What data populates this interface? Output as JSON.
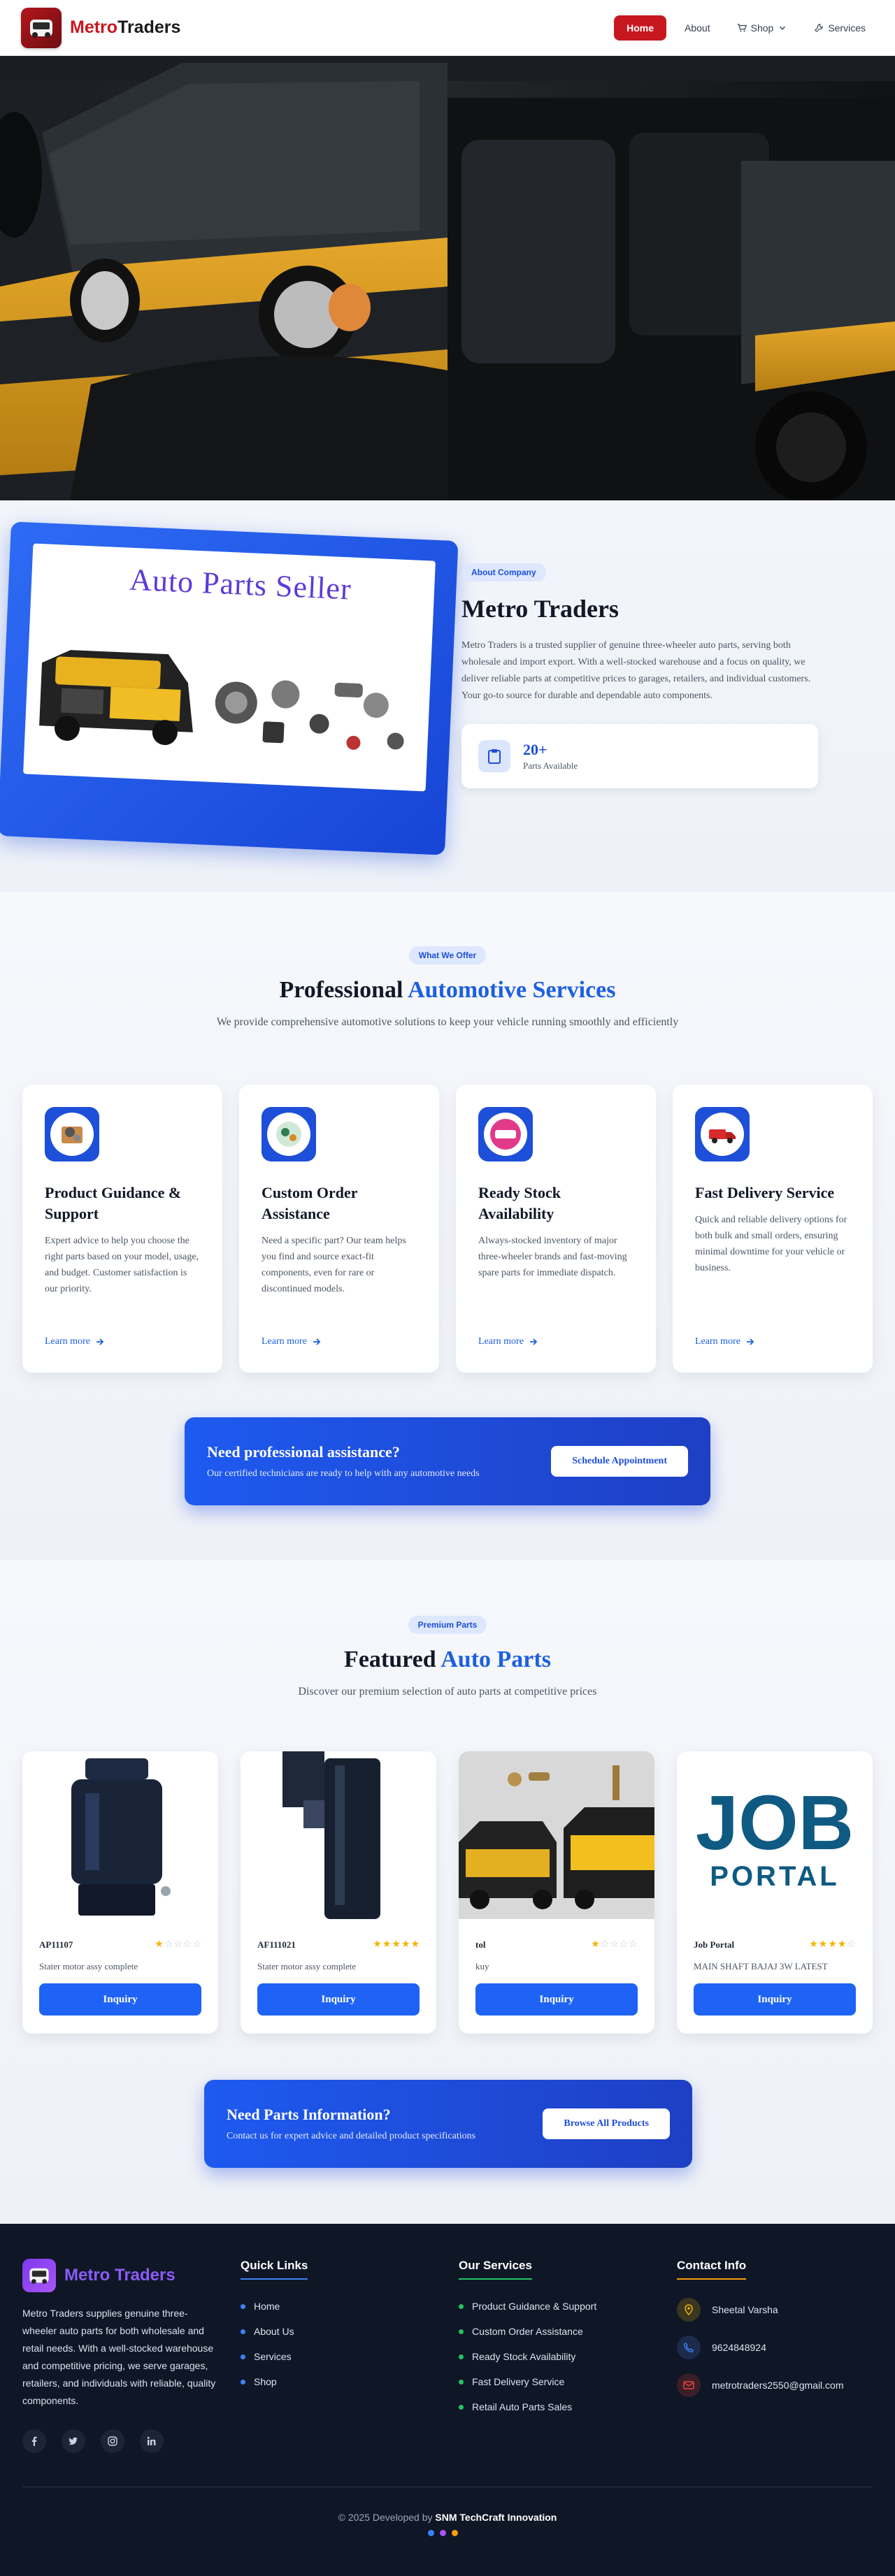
{
  "nav": {
    "brand_part1": "Metro",
    "brand_part2": "Traders",
    "links": {
      "home": "Home",
      "about": "About",
      "shop": "Shop",
      "services": "Services"
    }
  },
  "about": {
    "badge": "About Company",
    "title": "Metro Traders",
    "image_text": "Auto Parts Seller",
    "description": "Metro Traders is a trusted supplier of genuine three-wheeler auto parts, serving both wholesale and import export. With a well-stocked warehouse and a focus on quality, we deliver reliable parts at competitive prices to garages, retailers, and individual customers. Your go-to source for durable and dependable auto components.",
    "stat_value": "20+",
    "stat_label": "Parts Available"
  },
  "services": {
    "badge": "What We Offer",
    "title_plain": "Professional",
    "title_accent": "Automotive Services",
    "subtitle": "We provide comprehensive automotive solutions to keep your vehicle running smoothly and efficiently",
    "cards": [
      {
        "title": "Product Guidance & Support",
        "text": "Expert advice to help you choose the right parts based on your model, usage, and budget. Customer satisfaction is our priority.",
        "link": "Learn more",
        "icon": "parts-box-icon"
      },
      {
        "title": "Custom Order Assistance",
        "text": "Need a specific part? Our team helps you find and source exact-fit components, even for rare or discontinued models.",
        "link": "Learn more",
        "icon": "custom-order-icon"
      },
      {
        "title": "Ready Stock Availability",
        "text": "Always-stocked inventory of major three-wheeler brands and fast-moving spare parts for immediate dispatch.",
        "link": "Learn more",
        "icon": "ready-stock-icon"
      },
      {
        "title": "Fast Delivery Service",
        "text": "Quick and reliable delivery options for both bulk and small orders, ensuring minimal downtime for your vehicle or business.",
        "link": "Learn more",
        "icon": "delivery-truck-icon"
      }
    ],
    "cta_title": "Need professional assistance?",
    "cta_text": "Our certified technicians are ready to help with any automotive needs",
    "cta_button": "Schedule Appointment"
  },
  "parts": {
    "badge": "Premium Parts",
    "title_plain": "Featured",
    "title_accent": "Auto Parts",
    "subtitle": "Discover our premium selection of auto parts at competitive prices",
    "products": [
      {
        "name": "AP11107",
        "rating": 1,
        "desc": "Stater motor assy complete",
        "button": "Inquiry"
      },
      {
        "name": "AF111021",
        "rating": 5,
        "desc": "Stater motor assy complete",
        "button": "Inquiry"
      },
      {
        "name": "tol",
        "rating": 1,
        "desc": "kuy",
        "button": "Inquiry"
      },
      {
        "name": "Job Portal",
        "rating": 4,
        "desc": "MAIN SHAFT BAJAJ 3W LATEST",
        "button": "Inquiry",
        "logo_part1": "JOB",
        "logo_part2": "PORTAL"
      }
    ],
    "cta_title": "Need Parts Information?",
    "cta_text": "Contact us for expert advice and detailed product specifications",
    "cta_button": "Browse All Products"
  },
  "footer": {
    "brand": "Metro Traders",
    "about": "Metro Traders supplies genuine three-wheeler auto parts for both wholesale and retail needs. With a well-stocked warehouse and competitive pricing, we serve garages, retailers, and individuals with reliable, quality components.",
    "quick_links_title": "Quick Links",
    "quick_links": [
      "Home",
      "About Us",
      "Services",
      "Shop"
    ],
    "services_title": "Our Services",
    "services": [
      "Product Guidance & Support",
      "Custom Order Assistance",
      "Ready Stock Availability",
      "Fast Delivery Service",
      "Retail Auto Parts Sales"
    ],
    "contact_title": "Contact Info",
    "contact_name": "Sheetal Varsha",
    "contact_phone": "9624848924",
    "contact_email": "metrotraders2550@gmail.com",
    "copyright_prefix": "© 2025 Developed by",
    "copyright_company": "SNM TechCraft Innovation"
  },
  "colors": {
    "brand_red": "#c8181f",
    "primary_blue": "#1d5fe0",
    "footer_bg": "#0f1626",
    "star": "#f5b301"
  }
}
